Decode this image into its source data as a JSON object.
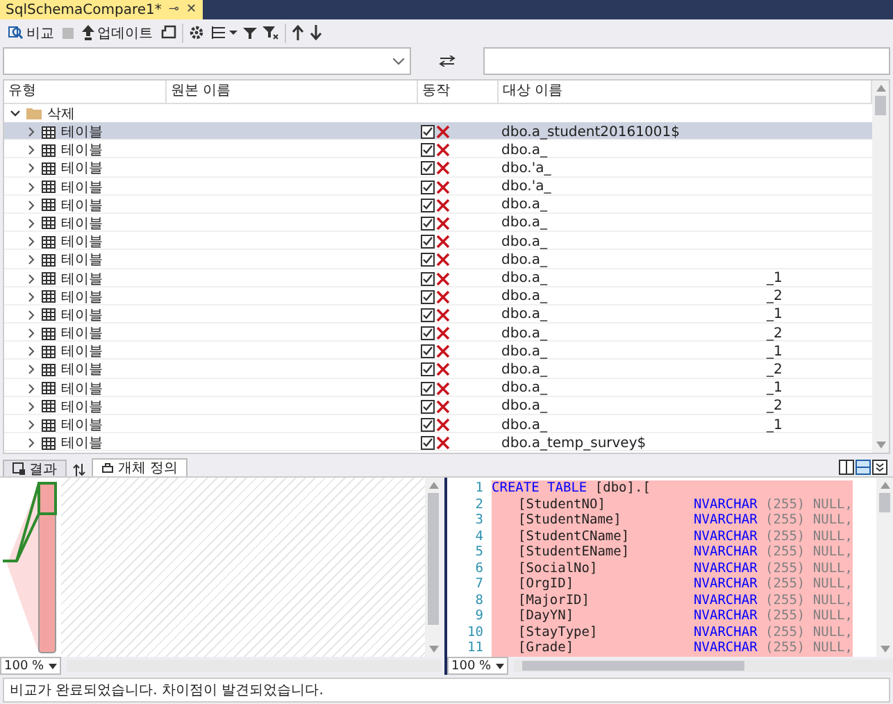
{
  "document_tab": {
    "title": "SqlSchemaCompare1*",
    "pin": "⊸",
    "close": "✕"
  },
  "toolbar": {
    "compare_label": "비교",
    "update_label": "업데이트"
  },
  "grid": {
    "columns": [
      "유형",
      "원본 이름",
      "동작",
      "대상 이름"
    ],
    "group": {
      "label": "삭제",
      "expanded": true,
      "children": [
        {
          "type": "테이블",
          "checked": true,
          "selected": true,
          "target": "dbo.a_student20161001$"
        },
        {
          "type": "테이블",
          "checked": true,
          "selected": false,
          "target": "dbo.a_"
        },
        {
          "type": "테이블",
          "checked": true,
          "selected": false,
          "target": "dbo.'a_"
        },
        {
          "type": "테이블",
          "checked": true,
          "selected": false,
          "target": "dbo.'a_"
        },
        {
          "type": "테이블",
          "checked": true,
          "selected": false,
          "target": "dbo.a_"
        },
        {
          "type": "테이블",
          "checked": true,
          "selected": false,
          "target": "dbo.a_"
        },
        {
          "type": "테이블",
          "checked": true,
          "selected": false,
          "target": "dbo.a_"
        },
        {
          "type": "테이블",
          "checked": true,
          "selected": false,
          "target": "dbo.a_"
        },
        {
          "type": "테이블",
          "checked": true,
          "selected": false,
          "target": "dbo.a_",
          "suffix": "_1"
        },
        {
          "type": "테이블",
          "checked": true,
          "selected": false,
          "target": "dbo.a_",
          "suffix": "_2"
        },
        {
          "type": "테이블",
          "checked": true,
          "selected": false,
          "target": "dbo.a_",
          "suffix": "_1"
        },
        {
          "type": "테이블",
          "checked": true,
          "selected": false,
          "target": "dbo.a_",
          "suffix": "_2"
        },
        {
          "type": "테이블",
          "checked": true,
          "selected": false,
          "target": "dbo.a_",
          "suffix": "_1"
        },
        {
          "type": "테이블",
          "checked": true,
          "selected": false,
          "target": "dbo.a_",
          "suffix": "_2"
        },
        {
          "type": "테이블",
          "checked": true,
          "selected": false,
          "target": "dbo.a_",
          "suffix": "_1"
        },
        {
          "type": "테이블",
          "checked": true,
          "selected": false,
          "target": "dbo.a_",
          "suffix": "_2"
        },
        {
          "type": "테이블",
          "checked": true,
          "selected": false,
          "target": "dbo.a_",
          "suffix": "_1"
        },
        {
          "type": "테이블",
          "checked": true,
          "selected": false,
          "target": "dbo.a_temp_survey$"
        }
      ]
    }
  },
  "bottom_tabs": [
    {
      "label": "결과",
      "selected": false
    },
    {
      "label": "개체 정의",
      "selected": true
    }
  ],
  "source_pane": {
    "zoom": "100 %"
  },
  "target_pane": {
    "zoom": "100 %",
    "lines": [
      {
        "kind": "create",
        "number": "1",
        "keyword": "CREATE TABLE",
        "name": "[dbo].["
      },
      {
        "kind": "column",
        "number": "2",
        "column": "[StudentNO]",
        "type": "NVARCHAR",
        "size": "(255)",
        "null": "NULL,"
      },
      {
        "kind": "column",
        "number": "3",
        "column": "[StudentName]",
        "type": "NVARCHAR",
        "size": "(255)",
        "null": "NULL,"
      },
      {
        "kind": "column",
        "number": "4",
        "column": "[StudentCName]",
        "type": "NVARCHAR",
        "size": "(255)",
        "null": "NULL,"
      },
      {
        "kind": "column",
        "number": "5",
        "column": "[StudentEName]",
        "type": "NVARCHAR",
        "size": "(255)",
        "null": "NULL,"
      },
      {
        "kind": "column",
        "number": "6",
        "column": "[SocialNo]",
        "type": "NVARCHAR",
        "size": "(255)",
        "null": "NULL,"
      },
      {
        "kind": "column",
        "number": "7",
        "column": "[OrgID]",
        "type": "NVARCHAR",
        "size": "(255)",
        "null": "NULL,"
      },
      {
        "kind": "column",
        "number": "8",
        "column": "[MajorID]",
        "type": "NVARCHAR",
        "size": "(255)",
        "null": "NULL,"
      },
      {
        "kind": "column",
        "number": "9",
        "column": "[DayYN]",
        "type": "NVARCHAR",
        "size": "(255)",
        "null": "NULL,"
      },
      {
        "kind": "column",
        "number": "10",
        "column": "[StayType]",
        "type": "NVARCHAR",
        "size": "(255)",
        "null": "NULL,"
      },
      {
        "kind": "column",
        "number": "11",
        "column": "[Grade]",
        "type": "NVARCHAR",
        "size": "(255)",
        "null": "NULL,"
      }
    ]
  },
  "status_bar": {
    "text": "비교가 완료되었습니다. 차이점이 발견되었습니다."
  }
}
